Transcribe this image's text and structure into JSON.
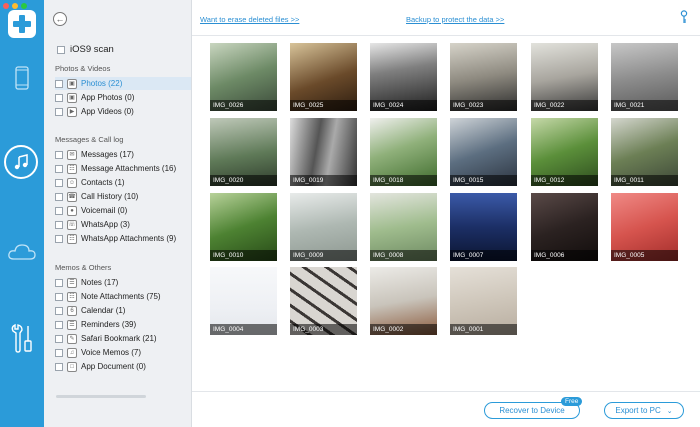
{
  "colors": {
    "accent": "#2b9bd9",
    "sidebar_bg": "#eef0f3",
    "selected_bg": "#dbe8f4"
  },
  "header": {
    "erase_link": "Want to erase deleted files >>",
    "backup_link": "Backup to protect the data >>"
  },
  "iconbar": {
    "items": [
      {
        "name": "device-icon"
      },
      {
        "name": "music-icon"
      },
      {
        "name": "cloud-icon"
      },
      {
        "name": "tools-icon"
      }
    ]
  },
  "sidebar": {
    "ios_scan": "iOS9 scan",
    "groups": [
      {
        "title": "Photos & Videos",
        "items": [
          {
            "label": "Photos (22)",
            "selected": true
          },
          {
            "label": "App Photos (0)"
          },
          {
            "label": "App Videos (0)"
          }
        ]
      },
      {
        "title": "Messages & Call log",
        "items": [
          {
            "label": "Messages (17)"
          },
          {
            "label": "Message Attachments (16)"
          },
          {
            "label": "Contacts (1)"
          },
          {
            "label": "Call History (10)"
          },
          {
            "label": "Voicemail (0)"
          },
          {
            "label": "WhatsApp (3)"
          },
          {
            "label": "WhatsApp Attachments (9)"
          }
        ]
      },
      {
        "title": "Memos & Others",
        "items": [
          {
            "label": "Notes (17)"
          },
          {
            "label": "Note Attachments (75)"
          },
          {
            "label": "Calendar (1)"
          },
          {
            "label": "Reminders (39)"
          },
          {
            "label": "Safari Bookmark (21)"
          },
          {
            "label": "Voice Memos (7)"
          },
          {
            "label": "App Document (0)"
          }
        ]
      }
    ]
  },
  "gallery": {
    "photos": [
      "IMG_0026",
      "IMG_0025",
      "IMG_0024",
      "IMG_0023",
      "IMG_0022",
      "IMG_0021",
      "IMG_0020",
      "IMG_0019",
      "IMG_0018",
      "IMG_0015",
      "IMG_0012",
      "IMG_0011",
      "IMG_0010",
      "IMG_0009",
      "IMG_0008",
      "IMG_0007",
      "IMG_0006",
      "IMG_0005",
      "IMG_0004",
      "IMG_0003",
      "IMG_0002",
      "IMG_0001"
    ]
  },
  "footer": {
    "recover_button": "Recover to Device",
    "free_badge": "Free",
    "export_button": "Export to PC"
  }
}
